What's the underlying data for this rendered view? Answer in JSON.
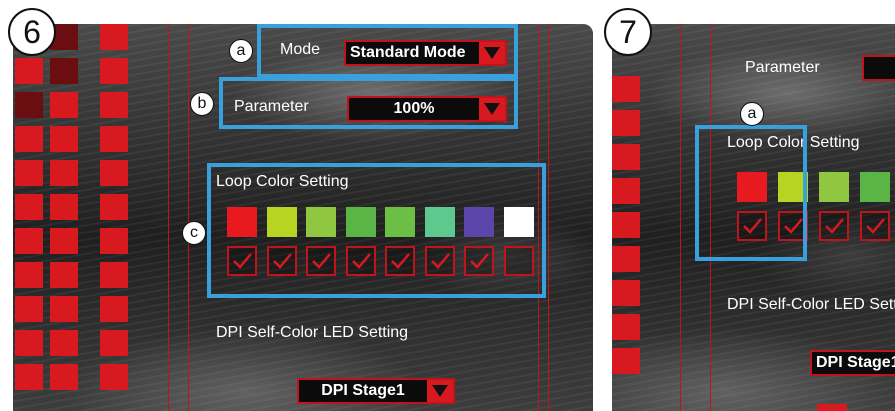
{
  "panel6": {
    "step_number": "6",
    "callouts": {
      "a": "a",
      "b": "b",
      "c": "c"
    },
    "mode_label": "Mode",
    "mode_value": "Standard Mode",
    "parameter_label": "Parameter",
    "parameter_value": "100%",
    "loop_color_label": "Loop Color Setting",
    "colors": [
      "#e8191f",
      "#b7d422",
      "#8fc740",
      "#5bb446",
      "#6cbf45",
      "#5fc88f",
      "#5b45a8",
      "#ffffff"
    ],
    "checked": [
      true,
      true,
      true,
      true,
      true,
      true,
      true,
      false
    ],
    "dpi_led_label": "DPI Self-Color LED Setting",
    "dpi_stage_value": "DPI Stage1"
  },
  "panel7": {
    "step_number": "7",
    "callouts": {
      "a": "a"
    },
    "parameter_label": "Parameter",
    "loop_color_label": "Loop Color Setting",
    "colors": [
      "#e8191f",
      "#b7d422",
      "#8fc740",
      "#5bb446"
    ],
    "checked": [
      true,
      true,
      true,
      true
    ],
    "dpi_led_label": "DPI Self-Color LED Setting",
    "dpi_stage_value": "DPI Stage1"
  },
  "accent_colors": {
    "highlight_blue": "#3aa0dc",
    "brand_red": "#d8191f"
  }
}
